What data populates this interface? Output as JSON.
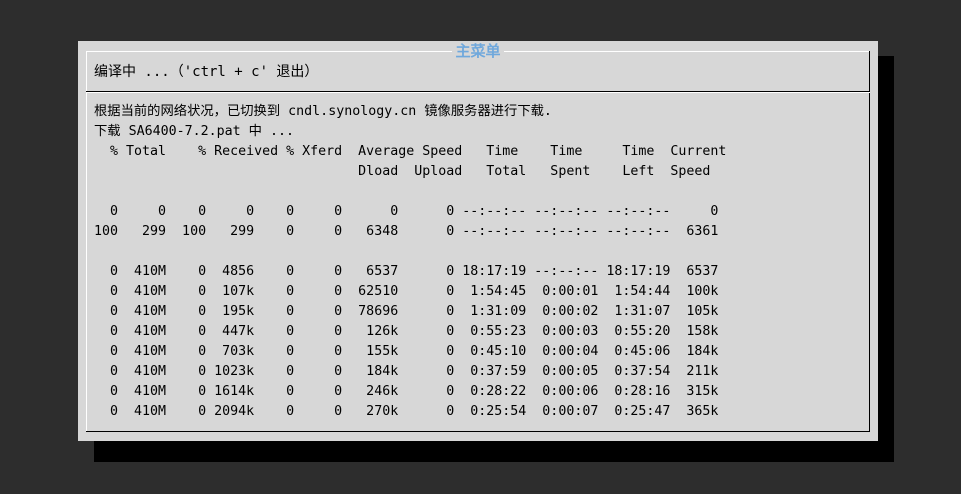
{
  "dialog": {
    "title": "主菜单",
    "subtitle": "编译中 ...（'ctrl + c' 退出）"
  },
  "terminal": {
    "lines": [
      "根据当前的网络状况，已切换到 cndl.synology.cn 镜像服务器进行下载.",
      "下载 SA6400-7.2.pat 中 ...",
      "  % Total    % Received % Xferd  Average Speed   Time    Time     Time  Current",
      "                                 Dload  Upload   Total   Spent    Left  Speed",
      "",
      "  0     0    0     0    0     0      0      0 --:--:-- --:--:-- --:--:--     0",
      "100   299  100   299    0     0   6348      0 --:--:-- --:--:-- --:--:--  6361",
      "",
      "  0  410M    0  4856    0     0   6537      0 18:17:19 --:--:-- 18:17:19  6537",
      "  0  410M    0  107k    0     0  62510      0  1:54:45  0:00:01  1:54:44  100k",
      "  0  410M    0  195k    0     0  78696      0  1:31:09  0:00:02  1:31:07  105k",
      "  0  410M    0  447k    0     0   126k      0  0:55:23  0:00:03  0:55:20  158k",
      "  0  410M    0  703k    0     0   155k      0  0:45:10  0:00:04  0:45:06  184k",
      "  0  410M    0 1023k    0     0   184k      0  0:37:59  0:00:05  0:37:54  211k",
      "  0  410M    0 1614k    0     0   246k      0  0:28:22  0:00:06  0:28:16  315k",
      "  0  410M    0 2094k    0     0   270k      0  0:25:54  0:00:07  0:25:47  365k"
    ]
  },
  "colors": {
    "background": "#2d2d2d",
    "dialog_bg": "#d7d7d7",
    "title": "#6fa8dc",
    "text": "#000000"
  }
}
